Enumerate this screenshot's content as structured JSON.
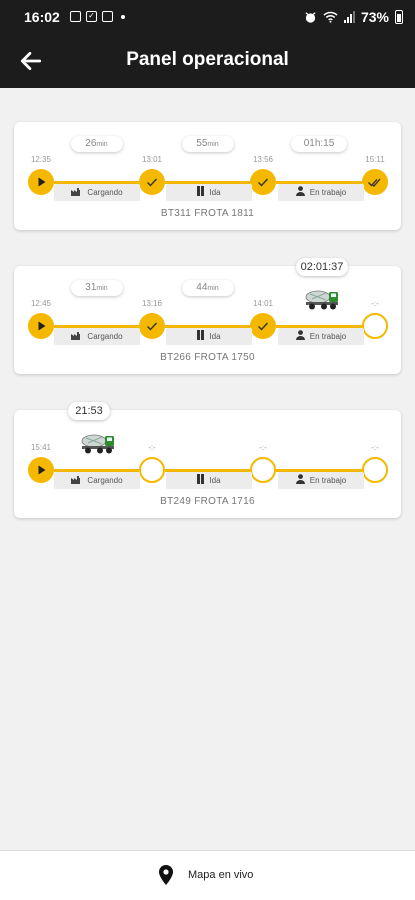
{
  "status_bar": {
    "time": "16:02",
    "battery": "73%",
    "icons": [
      "photo-icon",
      "check-icon",
      "mail-icon",
      "alarm-icon",
      "wifi-icon",
      "signal-icon",
      "battery-icon"
    ]
  },
  "header": {
    "title": "Panel operacional"
  },
  "stage_labels": [
    "Cargando",
    "Ida",
    "En trabajo"
  ],
  "trips": [
    {
      "timestamps": [
        "12:35",
        "13:01",
        "13:56",
        "15:11"
      ],
      "durations": [
        {
          "value": "26",
          "unit": "min"
        },
        {
          "value": "55",
          "unit": "min"
        },
        {
          "value": "01h:15",
          "unit": ""
        }
      ],
      "states": [
        "play",
        "done",
        "done",
        "complete"
      ],
      "timer": "",
      "fleet": "BT311 FROTA 1811"
    },
    {
      "timestamps": [
        "12:45",
        "13:16",
        "14:01",
        "-:-"
      ],
      "durations": [
        {
          "value": "31",
          "unit": "min"
        },
        {
          "value": "44",
          "unit": "min"
        }
      ],
      "states": [
        "play",
        "done",
        "done",
        "empty"
      ],
      "timer": "02:01:37",
      "fleet": "BT266 FROTA 1750"
    },
    {
      "timestamps": [
        "15:41",
        "-:-",
        "-:-",
        "-:-"
      ],
      "durations": [],
      "states": [
        "play",
        "empty",
        "empty",
        "empty"
      ],
      "timer": "21:53",
      "fleet": "BT249 FROTA 1716"
    }
  ],
  "bottom_bar": {
    "map_label": "Mapa en vivo"
  },
  "colors": {
    "accent": "#f5b800",
    "header": "#1c1c1c",
    "background": "#f1f1f1"
  }
}
